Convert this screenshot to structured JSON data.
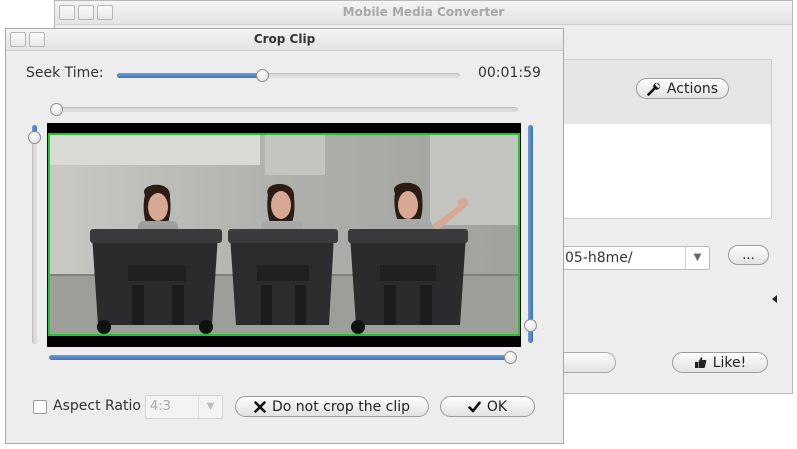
{
  "back_window": {
    "title": "Mobile Media Converter",
    "actions_label": "Actions",
    "path_value": "05-h8me/",
    "browse_label": "...",
    "like_label": "Like!"
  },
  "dialog": {
    "title": "Crop Clip",
    "seek_label": "Seek Time:",
    "seek_time": "00:01:59",
    "seek_progress": 0.42,
    "aspect_ratio_label": "Aspect Ratio",
    "aspect_ratio_checked": false,
    "aspect_ratio_value": "4:3",
    "no_crop_label": "Do not crop the clip",
    "ok_label": "OK"
  },
  "colors": {
    "accent_blue": "#3f74b9",
    "crop_border": "#21c42f"
  },
  "icons": {
    "actions": "wrench-icon",
    "like": "thumbs-up-icon",
    "no_crop": "x-icon",
    "ok": "checkmark-icon"
  }
}
